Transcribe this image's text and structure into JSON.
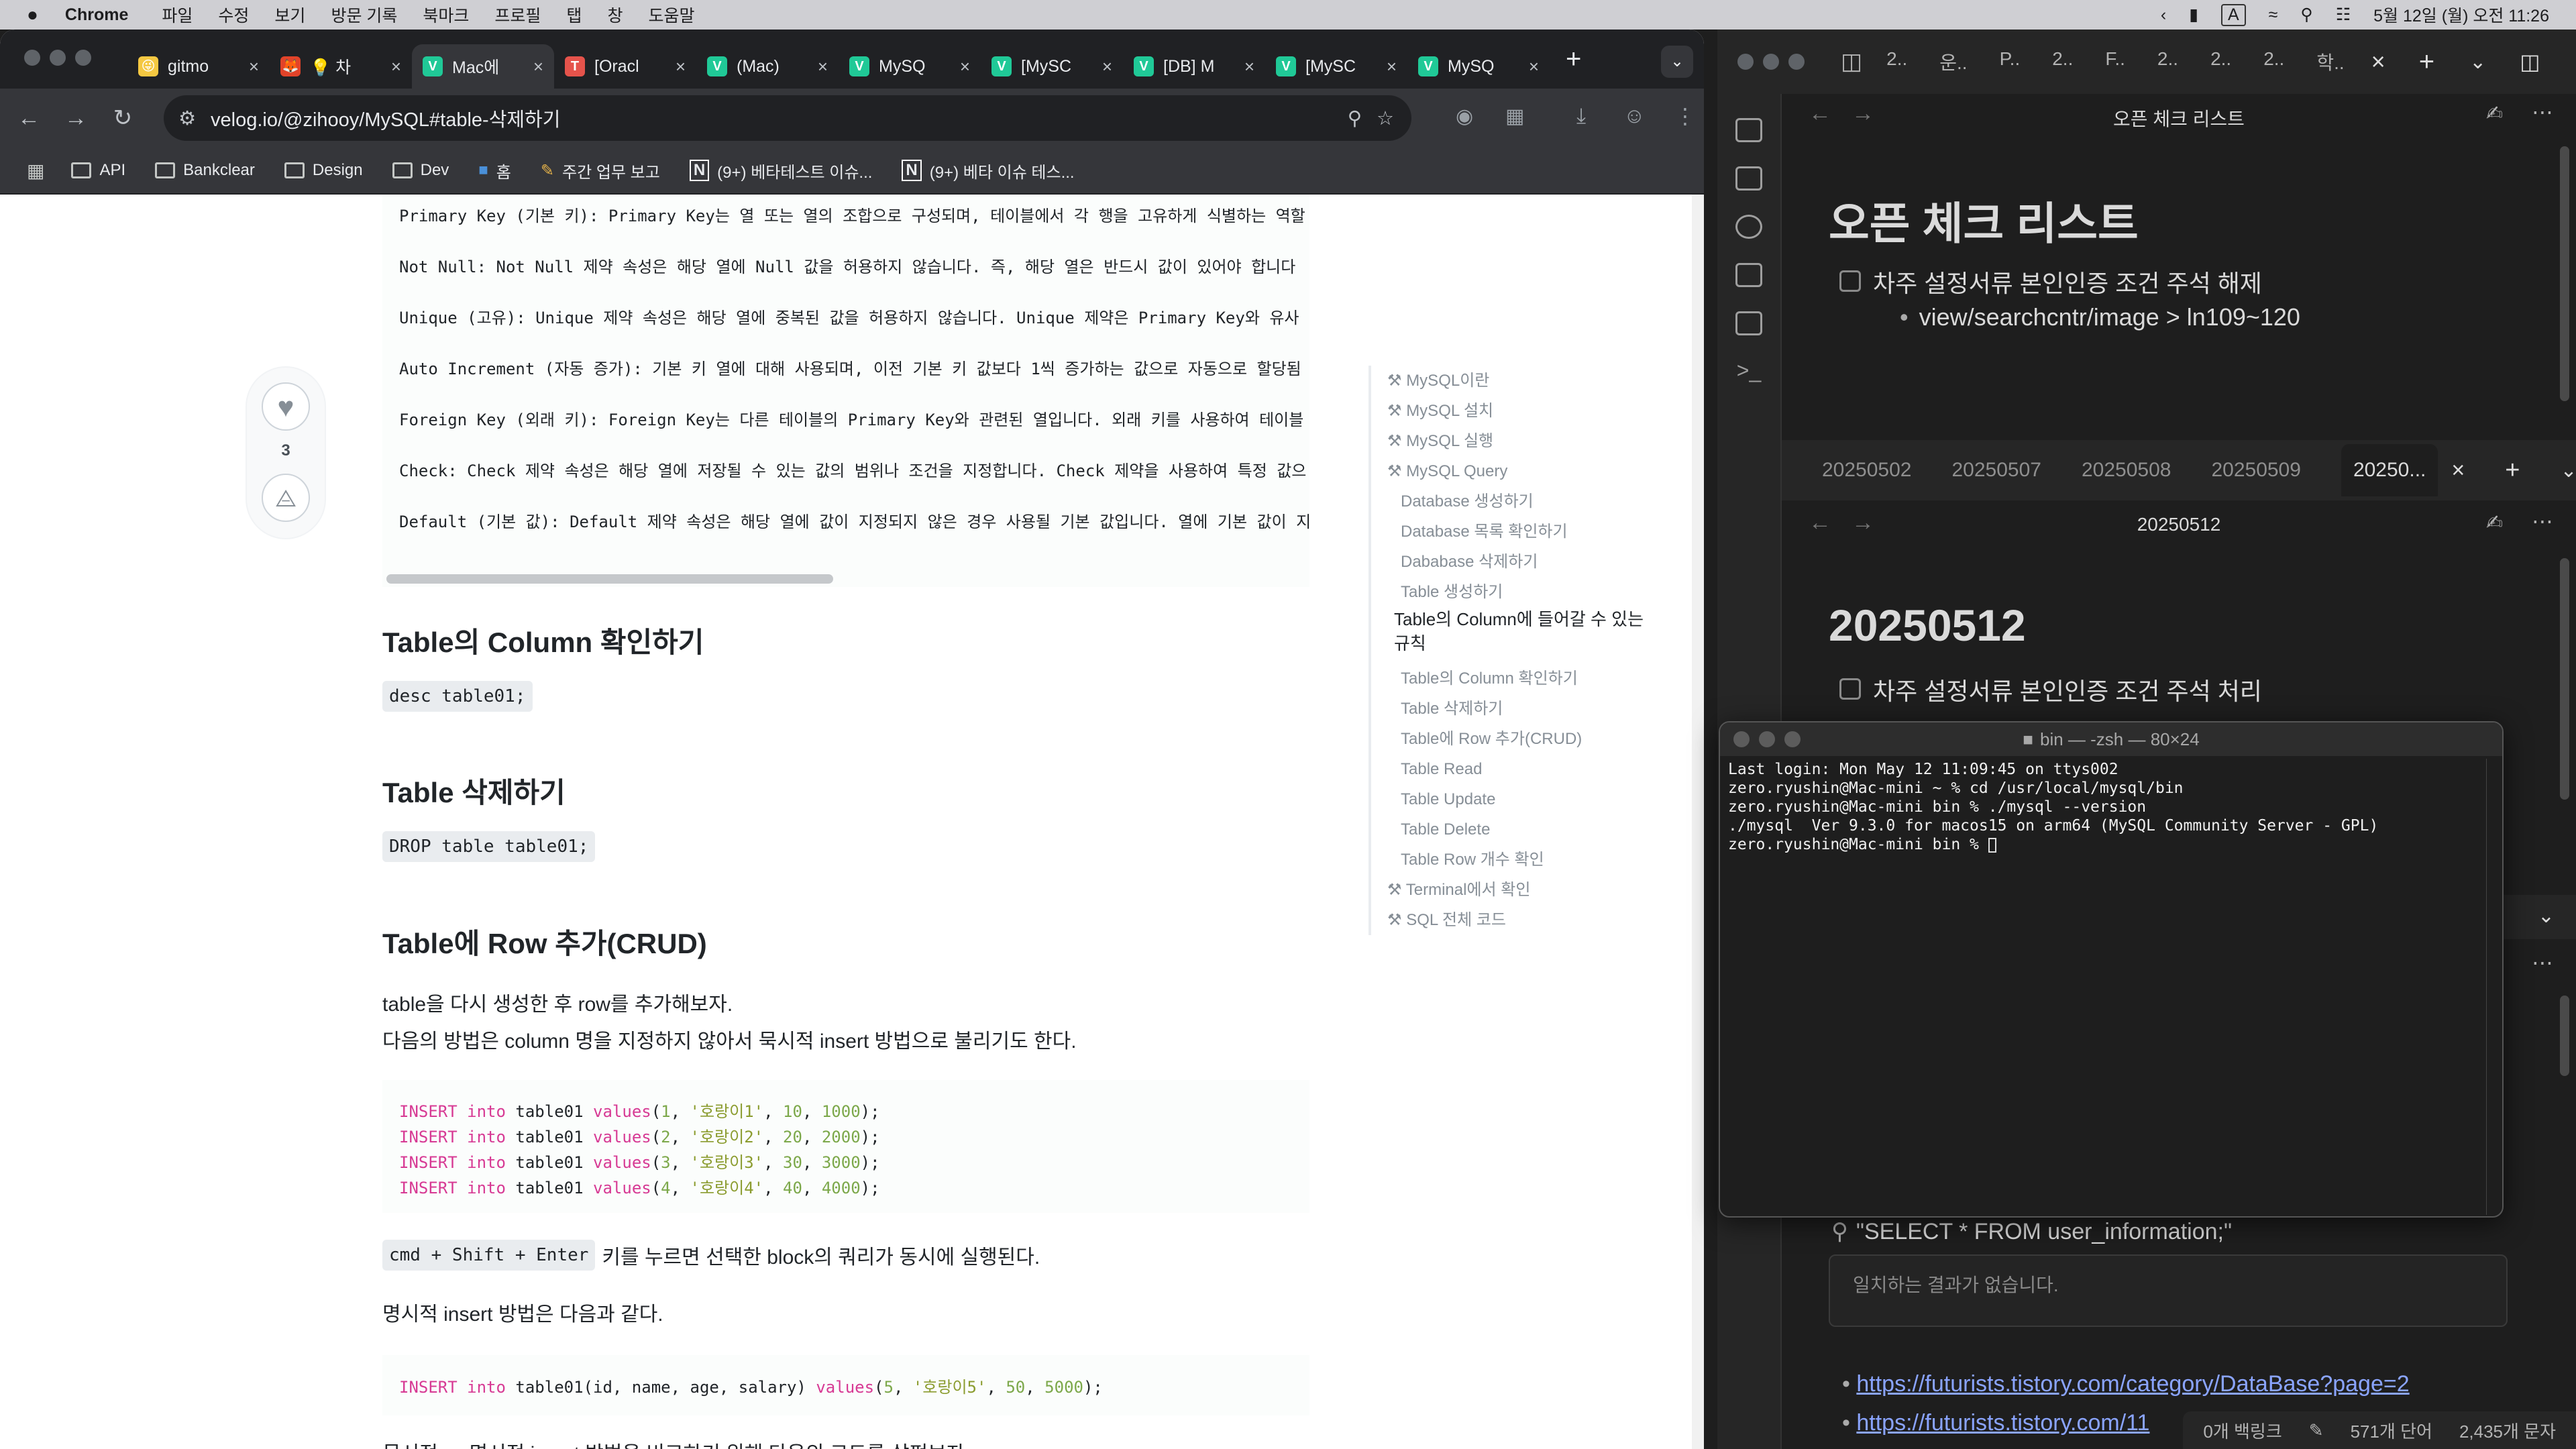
{
  "menubar": {
    "app": "Chrome",
    "items": [
      "파일",
      "수정",
      "보기",
      "방문 기록",
      "북마크",
      "프로필",
      "탭",
      "창",
      "도움말"
    ],
    "clock": "5월 12일 (월) 오전 11:26",
    "input_mode": "A"
  },
  "browser": {
    "tabs": [
      {
        "title": "gitmo",
        "color": "#f5c842",
        "icon": "😜"
      },
      {
        "title": "💡 차",
        "color": "#e24329",
        "icon": "🦊"
      },
      {
        "title": "Mac에",
        "color": "#20c997",
        "icon": "V",
        "active": true
      },
      {
        "title": "[Oracl",
        "color": "#e5534b",
        "icon": "T"
      },
      {
        "title": "(Mac)",
        "color": "#20c997",
        "icon": "V"
      },
      {
        "title": "MySQ",
        "color": "#20c997",
        "icon": "V"
      },
      {
        "title": "[MySC",
        "color": "#20c997",
        "icon": "V"
      },
      {
        "title": "[DB] M",
        "color": "#20c997",
        "icon": "V"
      },
      {
        "title": "[MySC",
        "color": "#20c997",
        "icon": "V"
      },
      {
        "title": "MySQ",
        "color": "#20c997",
        "icon": "V"
      }
    ],
    "url": "velog.io/@zihooy/MySQL#table-삭제하기",
    "bookmarks": [
      "API",
      "Bankclear",
      "Design",
      "Dev",
      "홈",
      "주간 업무 보고",
      "(9+) 베타테스트 이슈...",
      "(9+) 베타 이슈 테스..."
    ]
  },
  "article": {
    "constraints": [
      "Primary Key (기본 키): Primary Key는 열 또는 열의 조합으로 구성되며, 테이블에서 각 행을 고유하게 식별하는 역할",
      "Not Null: Not Null 제약 속성은 해당 열에 Null 값을 허용하지 않습니다. 즉, 해당 열은 반드시 값이 있어야 합니다",
      "Unique (고유): Unique 제약 속성은 해당 열에 중복된 값을 허용하지 않습니다. Unique 제약은 Primary Key와 유사",
      "Auto Increment (자동 증가): 기본 키 열에 대해 사용되며, 이전 기본 키 값보다 1씩 증가하는 값으로 자동으로 할당됨",
      "Foreign Key (외래 키): Foreign Key는 다른 테이블의 Primary Key와 관련된 열입니다. 외래 키를 사용하여 테이블",
      "Check: Check 제약 속성은 해당 열에 저장될 수 있는 값의 범위나 조건을 지정합니다. Check 제약을 사용하여 특정 값으",
      "Default (기본 값): Default 제약 속성은 해당 열에 값이 지정되지 않은 경우 사용될 기본 값입니다. 열에 기본 값이 지"
    ],
    "likes": "3",
    "h_column": "Table의 Column 확인하기",
    "code_desc": "desc table01;",
    "h_delete": "Table 삭제하기",
    "code_drop": "DROP table table01;",
    "h_row": "Table에 Row 추가(CRUD)",
    "p1": "table을 다시 생성한 후 row를 추가해보자.",
    "p2": "다음의 방법은 column 명을 지정하지 않아서 묵시적 insert 방법으로 불리기도 한다.",
    "inserts": [
      {
        "n": "1",
        "name": "'호랑이1'",
        "age": "10",
        "sal": "1000"
      },
      {
        "n": "2",
        "name": "'호랑이2'",
        "age": "20",
        "sal": "2000"
      },
      {
        "n": "3",
        "name": "'호랑이3'",
        "age": "30",
        "sal": "3000"
      },
      {
        "n": "4",
        "name": "'호랑이4'",
        "age": "40",
        "sal": "4000"
      }
    ],
    "kw_insert": "INSERT",
    "kw_into": "into",
    "kw_values": "values",
    "tbl": "table01",
    "shortcut": "cmd + Shift + Enter",
    "shortcut_desc": "키를 누르면 선택한 block의 쿼리가 동시에 실행된다.",
    "p3": "명시적 insert 방법은 다음과 같다.",
    "explicit_cols": "table01(id, name, age, salary)",
    "explicit": {
      "n": "5",
      "name": "'호랑이5'",
      "age": "50",
      "sal": "5000"
    },
    "p4": "묵시적 vs 명시적 insert 방법을 비교하기 위해 다음의 코드를 살펴보자."
  },
  "toc": [
    {
      "t": "MySQL이란",
      "lvl": 0
    },
    {
      "t": "MySQL 설치",
      "lvl": 0
    },
    {
      "t": "MySQL 실행",
      "lvl": 0
    },
    {
      "t": "MySQL Query",
      "lvl": 0
    },
    {
      "t": "Database 생성하기",
      "lvl": 1
    },
    {
      "t": "Database 목록 확인하기",
      "lvl": 1
    },
    {
      "t": "Dababase 삭제하기",
      "lvl": 1
    },
    {
      "t": "Table 생성하기",
      "lvl": 1
    },
    {
      "t": "Table의 Column에 들어갈 수 있는 규칙",
      "lvl": 2
    },
    {
      "t": "Table의 Column 확인하기",
      "lvl": 1
    },
    {
      "t": "Table 삭제하기",
      "lvl": 1
    },
    {
      "t": "Table에 Row 추가(CRUD)",
      "lvl": 1
    },
    {
      "t": "Table Read",
      "lvl": 1
    },
    {
      "t": "Table Update",
      "lvl": 1
    },
    {
      "t": "Table Delete",
      "lvl": 1
    },
    {
      "t": "Table Row 개수 확인",
      "lvl": 1
    },
    {
      "t": "Terminal에서 확인",
      "lvl": 0
    },
    {
      "t": "SQL 전체 코드",
      "lvl": 0
    }
  ],
  "notes": {
    "top_tabs": [
      "2..",
      "운..",
      "P..",
      "2..",
      "F..",
      "2..",
      "2..",
      "2..",
      "학.."
    ],
    "pane1_header": "오픈 체크 리스트",
    "pane1_title": "오픈 체크 리스트",
    "pane1_item": "차주 설정서류 본인인증 조건 주석 해제",
    "pane1_sub": "view/searchcntr/image > ln109~120",
    "date_tabs": [
      "20250502",
      "20250507",
      "20250508",
      "20250509",
      "20250..."
    ],
    "pane2_header": "20250512",
    "pane2_title": "20250512",
    "pane2_item": "차주 설정서류 본인인증 조건 주석 처리",
    "search_query": "\"SELECT * FROM user_information;\"",
    "search_empty": "일치하는 결과가 없습니다.",
    "links": [
      "https://futurists.tistory.com/category/DataBase?page=2",
      "https://futurists.tistory.com/11"
    ],
    "status": [
      "0개 백링크",
      "571개 단어",
      "2,435개 문자"
    ]
  },
  "terminal": {
    "title": "bin — -zsh — 80×24",
    "lines": [
      "Last login: Mon May 12 11:09:45 on ttys002",
      "zero.ryushin@Mac-mini ~ % cd /usr/local/mysql/bin",
      "zero.ryushin@Mac-mini bin % ./mysql --version",
      "./mysql  Ver 9.3.0 for macos15 on arm64 (MySQL Community Server - GPL)",
      "zero.ryushin@Mac-mini bin % "
    ]
  }
}
